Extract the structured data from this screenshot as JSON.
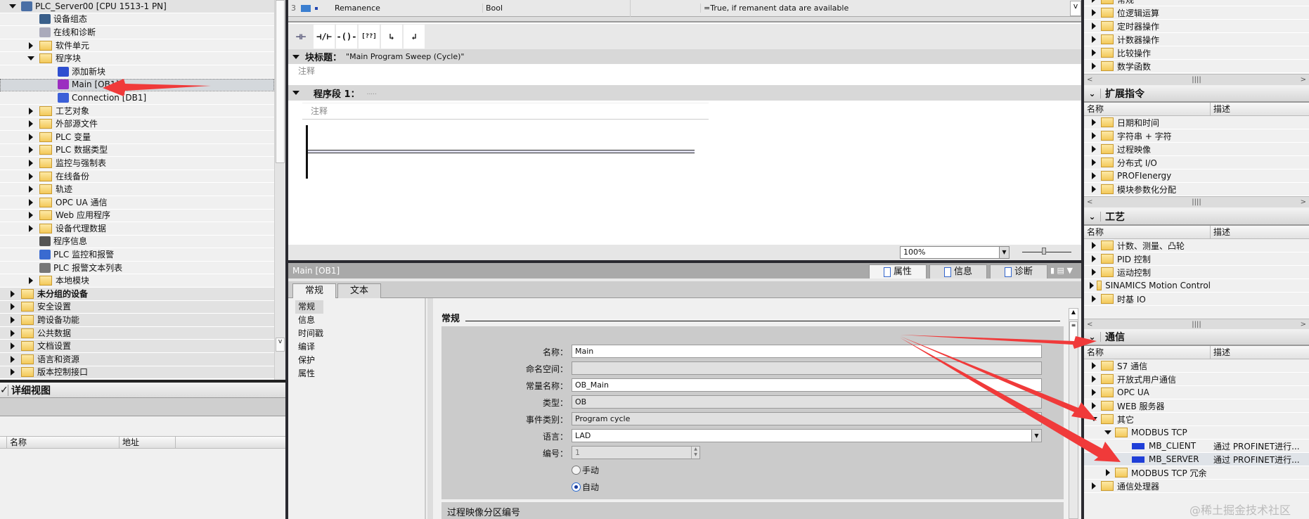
{
  "tree": {
    "items": [
      {
        "label": "PLC_Server00 [CPU 1513-1 PN]",
        "level": 0,
        "exp": "down",
        "icon": "plc-icon"
      },
      {
        "label": "设备组态",
        "level": 1,
        "exp": "",
        "icon": "device-config-icon"
      },
      {
        "label": "在线和诊断",
        "level": 1,
        "exp": "",
        "icon": "online-diagnostics-icon"
      },
      {
        "label": "软件单元",
        "level": 1,
        "exp": "right",
        "icon": "folder-icon"
      },
      {
        "label": "程序块",
        "level": 1,
        "exp": "down",
        "icon": "folder-icon"
      },
      {
        "label": "添加新块",
        "level": 2,
        "exp": "",
        "icon": "add-block-icon"
      },
      {
        "label": "Main [OB1]",
        "level": 2,
        "exp": "",
        "icon": "ob-block-icon",
        "selected": true
      },
      {
        "label": "Connection [DB1]",
        "level": 2,
        "exp": "",
        "icon": "db-block-icon"
      },
      {
        "label": "工艺对象",
        "level": 1,
        "exp": "right",
        "icon": "folder-icon"
      },
      {
        "label": "外部源文件",
        "level": 1,
        "exp": "right",
        "icon": "folder-icon"
      },
      {
        "label": "PLC 变量",
        "level": 1,
        "exp": "right",
        "icon": "folder-icon"
      },
      {
        "label": "PLC 数据类型",
        "level": 1,
        "exp": "right",
        "icon": "folder-icon"
      },
      {
        "label": "监控与强制表",
        "level": 1,
        "exp": "right",
        "icon": "folder-icon"
      },
      {
        "label": "在线备份",
        "level": 1,
        "exp": "right",
        "icon": "folder-icon"
      },
      {
        "label": "轨迹",
        "level": 1,
        "exp": "right",
        "icon": "folder-icon"
      },
      {
        "label": "OPC UA 通信",
        "level": 1,
        "exp": "right",
        "icon": "folder-icon"
      },
      {
        "label": "Web 应用程序",
        "level": 1,
        "exp": "right",
        "icon": "folder-icon"
      },
      {
        "label": "设备代理数据",
        "level": 1,
        "exp": "right",
        "icon": "folder-icon"
      },
      {
        "label": "程序信息",
        "level": 1,
        "exp": "",
        "icon": "program-info-icon"
      },
      {
        "label": "PLC 监控和报警",
        "level": 1,
        "exp": "",
        "icon": "alarm-icon"
      },
      {
        "label": "PLC 报警文本列表",
        "level": 1,
        "exp": "",
        "icon": "text-list-icon"
      },
      {
        "label": "本地模块",
        "level": 1,
        "exp": "right",
        "icon": "folder-icon"
      },
      {
        "label": "未分组的设备",
        "level": 0,
        "exp": "right",
        "icon": "folder-icon",
        "bold": true
      },
      {
        "label": "安全设置",
        "level": 0,
        "exp": "right",
        "icon": "folder-icon"
      },
      {
        "label": "跨设备功能",
        "level": 0,
        "exp": "right",
        "icon": "folder-icon"
      },
      {
        "label": "公共数据",
        "level": 0,
        "exp": "right",
        "icon": "folder-icon"
      },
      {
        "label": "文档设置",
        "level": 0,
        "exp": "right",
        "icon": "folder-icon"
      },
      {
        "label": "语言和资源",
        "level": 0,
        "exp": "right",
        "icon": "folder-icon"
      },
      {
        "label": "版本控制接口",
        "level": 0,
        "exp": "right",
        "icon": "folder-icon"
      }
    ]
  },
  "detail": {
    "title": "详细视图",
    "col_name": "名称",
    "col_address": "地址"
  },
  "editor": {
    "iface_row": {
      "num": "3",
      "name": "Remanence",
      "type": "Bool",
      "comment": "=True, if remanent data are available"
    },
    "block_title_label": "块标题：",
    "block_title_value": "\"Main Program Sweep (Cycle)\"",
    "comment": "注释",
    "network_label": "程序段 1：",
    "network_title": ".....",
    "network_comment": "注释",
    "zoom": "100%"
  },
  "props": {
    "title": "Main [OB1]",
    "tabs": [
      "属性",
      "信息",
      "诊断"
    ],
    "subtabs": [
      "常规",
      "文本"
    ],
    "nav": [
      "常规",
      "信息",
      "时间戳",
      "编译",
      "保护",
      "属性"
    ],
    "section": "常规",
    "fields": {
      "name_label": "名称：",
      "name": "Main",
      "ns_label": "命名空间：",
      "ns": "",
      "const_label": "常量名称：",
      "const": "OB_Main",
      "type_label": "类型：",
      "type": "OB",
      "event_label": "事件类别：",
      "event": "Program cycle",
      "lang_label": "语言：",
      "lang": "LAD",
      "num_label": "编号：",
      "num": "1",
      "manual": "手动",
      "auto": "自动"
    },
    "section2": "过程映像分区编号"
  },
  "right": {
    "top_items": [
      "常规",
      "位逻辑运算",
      "定时器操作",
      "计数器操作",
      "比较操作",
      "数学函数"
    ],
    "ext": {
      "title": "扩展指令",
      "col_name": "名称",
      "col_desc": "描述",
      "items": [
        "日期和时间",
        "字符串 + 字符",
        "过程映像",
        "分布式 I/O",
        "PROFIenergy",
        "模块参数化分配"
      ]
    },
    "tech": {
      "title": "工艺",
      "col_name": "名称",
      "col_desc": "描述",
      "items": [
        "计数、测量、凸轮",
        "PID 控制",
        "运动控制",
        "SINAMICS Motion Control",
        "时基 IO"
      ]
    },
    "comm": {
      "title": "通信",
      "col_name": "名称",
      "col_desc": "描述",
      "items": [
        {
          "label": "S7 通信",
          "level": 0,
          "exp": "right",
          "kind": "folder",
          "desc": ""
        },
        {
          "label": "开放式用户通信",
          "level": 0,
          "exp": "right",
          "kind": "folder",
          "desc": ""
        },
        {
          "label": "OPC UA",
          "level": 0,
          "exp": "right",
          "kind": "folder",
          "desc": ""
        },
        {
          "label": "WEB 服务器",
          "level": 0,
          "exp": "right",
          "kind": "folder",
          "desc": ""
        },
        {
          "label": "其它",
          "level": 0,
          "exp": "down",
          "kind": "folder",
          "desc": ""
        },
        {
          "label": "MODBUS TCP",
          "level": 1,
          "exp": "down",
          "kind": "folder",
          "desc": ""
        },
        {
          "label": "MB_CLIENT",
          "level": 2,
          "exp": "",
          "kind": "block",
          "desc": "通过 PROFINET进行..."
        },
        {
          "label": "MB_SERVER",
          "level": 2,
          "exp": "",
          "kind": "block",
          "desc": "通过 PROFINET进行...",
          "selected": true
        },
        {
          "label": "MODBUS TCP 冗余",
          "level": 1,
          "exp": "right",
          "kind": "folder",
          "desc": ""
        },
        {
          "label": "通信处理器",
          "level": 0,
          "exp": "right",
          "kind": "folder",
          "desc": ""
        }
      ]
    }
  },
  "watermark": "@稀土掘金技术社区",
  "colors": {
    "arrow": "#f03a3a",
    "divider": "#2a2a30",
    "selected": "#d4d8dc"
  }
}
